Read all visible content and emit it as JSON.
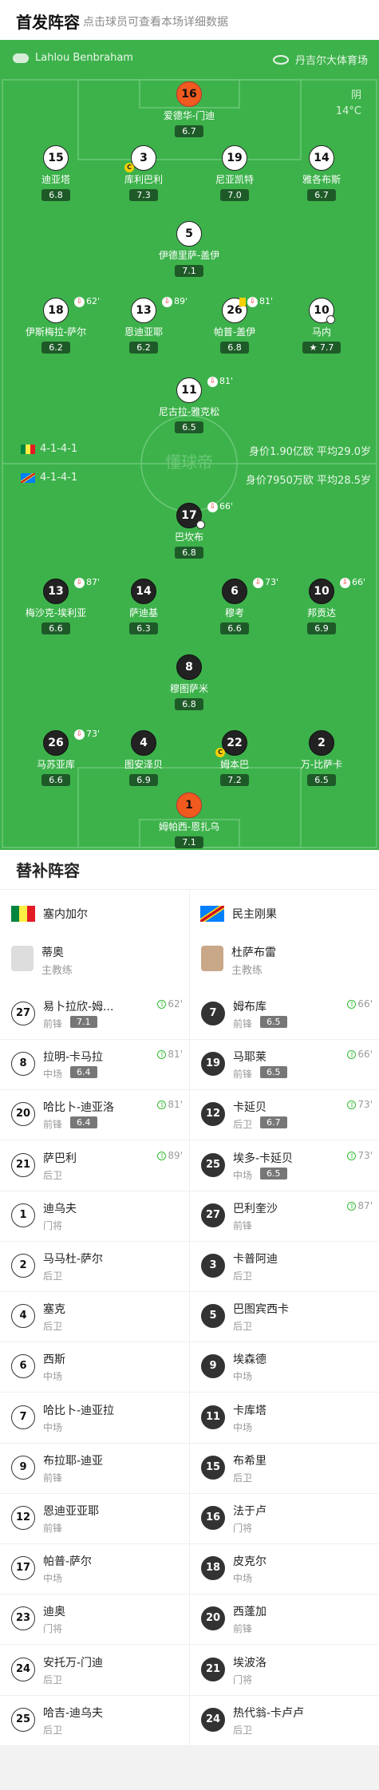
{
  "header": {
    "title": "首发阵容",
    "subtitle": "点击球员可查看本场详细数据"
  },
  "pitch": {
    "referee": "Lahlou Benbraham",
    "stadium": "丹吉尔大体育场",
    "weather": "阴",
    "temperature": "14°C",
    "watermark": "懂球帝",
    "home": {
      "formation": "4-1-4-1",
      "value": "身价1.90亿欧",
      "age": "平均29.0岁",
      "flag_colors": [
        "#00853f",
        "#fdef42",
        "#e31b23"
      ]
    },
    "away": {
      "formation": "4-1-4-1",
      "value": "身价7950万欧",
      "age": "平均28.5岁",
      "flag_colors": [
        "#007fff",
        "#f7d618",
        "#ce1021"
      ]
    }
  },
  "home_players": [
    {
      "num": "16",
      "name": "爱德华-门迪",
      "rating": "6.7"
    },
    {
      "num": "15",
      "name": "迪亚塔",
      "rating": "6.8"
    },
    {
      "num": "3",
      "name": "库利巴利",
      "rating": "7.3"
    },
    {
      "num": "19",
      "name": "尼亚凯特",
      "rating": "7.0"
    },
    {
      "num": "14",
      "name": "雅各布斯",
      "rating": "6.7"
    },
    {
      "num": "5",
      "name": "伊德里萨-盖伊",
      "rating": "7.1"
    },
    {
      "num": "18",
      "name": "伊斯梅拉-萨尔",
      "rating": "6.2",
      "sub": "62'"
    },
    {
      "num": "13",
      "name": "恩迪亚耶",
      "rating": "6.2",
      "sub": "89'"
    },
    {
      "num": "26",
      "name": "帕普-盖伊",
      "rating": "6.8",
      "sub": "81'"
    },
    {
      "num": "10",
      "name": "马内",
      "rating": "7.7"
    },
    {
      "num": "11",
      "name": "尼古拉-雅克松",
      "rating": "6.5",
      "sub": "81'"
    }
  ],
  "away_players": [
    {
      "num": "17",
      "name": "巴坎布",
      "rating": "6.8",
      "sub": "66'"
    },
    {
      "num": "13",
      "name": "梅沙克-埃利亚",
      "rating": "6.6",
      "sub": "87'"
    },
    {
      "num": "14",
      "name": "萨迪基",
      "rating": "6.3"
    },
    {
      "num": "6",
      "name": "穆考",
      "rating": "6.6",
      "sub": "73'"
    },
    {
      "num": "10",
      "name": "邦贡达",
      "rating": "6.9",
      "sub": "66'"
    },
    {
      "num": "8",
      "name": "穆图萨米",
      "rating": "6.8"
    },
    {
      "num": "26",
      "name": "马苏亚库",
      "rating": "6.6",
      "sub": "73'"
    },
    {
      "num": "4",
      "name": "图安泽贝",
      "rating": "6.9"
    },
    {
      "num": "22",
      "name": "姆本巴",
      "rating": "7.2"
    },
    {
      "num": "2",
      "name": "万-比萨卡",
      "rating": "6.5"
    },
    {
      "num": "1",
      "name": "姆帕西-恩扎乌",
      "rating": "7.1"
    }
  ],
  "bench": {
    "title": "替补阵容",
    "home_team": "塞内加尔",
    "away_team": "民主刚果",
    "home_coach": {
      "name": "蒂奥",
      "role": "主教练"
    },
    "away_coach": {
      "name": "杜萨布雷",
      "role": "主教练"
    },
    "home": [
      {
        "num": "27",
        "name": "易卜拉欣-姆...",
        "pos": "前锋",
        "rating": "7.1",
        "min": "62'"
      },
      {
        "num": "8",
        "name": "拉明-卡马拉",
        "pos": "中场",
        "rating": "6.4",
        "min": "81'"
      },
      {
        "num": "20",
        "name": "哈比卜-迪亚洛",
        "pos": "前锋",
        "rating": "6.4",
        "min": "81'"
      },
      {
        "num": "21",
        "name": "萨巴利",
        "pos": "后卫",
        "min": "89'"
      },
      {
        "num": "1",
        "name": "迪乌夫",
        "pos": "门将"
      },
      {
        "num": "2",
        "name": "马马杜-萨尔",
        "pos": "后卫"
      },
      {
        "num": "4",
        "name": "塞克",
        "pos": "后卫"
      },
      {
        "num": "6",
        "name": "西斯",
        "pos": "中场"
      },
      {
        "num": "7",
        "name": "哈比卜-迪亚拉",
        "pos": "中场"
      },
      {
        "num": "9",
        "name": "布拉耶-迪亚",
        "pos": "前锋"
      },
      {
        "num": "12",
        "name": "恩迪亚亚耶",
        "pos": "前锋"
      },
      {
        "num": "17",
        "name": "帕普-萨尔",
        "pos": "中场"
      },
      {
        "num": "23",
        "name": "迪奥",
        "pos": "门将"
      },
      {
        "num": "24",
        "name": "安托万-门迪",
        "pos": "后卫"
      },
      {
        "num": "25",
        "name": "哈吉-迪乌夫",
        "pos": "后卫"
      }
    ],
    "away": [
      {
        "num": "7",
        "name": "姆布库",
        "pos": "前锋",
        "rating": "6.5",
        "min": "66'"
      },
      {
        "num": "19",
        "name": "马耶莱",
        "pos": "前锋",
        "rating": "6.5",
        "min": "66'"
      },
      {
        "num": "12",
        "name": "卡延贝",
        "pos": "后卫",
        "rating": "6.7",
        "min": "73'"
      },
      {
        "num": "25",
        "name": "埃多-卡延贝",
        "pos": "中场",
        "rating": "6.5",
        "min": "73'"
      },
      {
        "num": "27",
        "name": "巴利奎沙",
        "pos": "前锋",
        "min": "87'"
      },
      {
        "num": "3",
        "name": "卡普阿迪",
        "pos": "后卫"
      },
      {
        "num": "5",
        "name": "巴图宾西卡",
        "pos": "后卫"
      },
      {
        "num": "9",
        "name": "埃森德",
        "pos": "中场"
      },
      {
        "num": "11",
        "name": "卡库塔",
        "pos": "中场"
      },
      {
        "num": "15",
        "name": "布希里",
        "pos": "后卫"
      },
      {
        "num": "16",
        "name": "法于卢",
        "pos": "门将"
      },
      {
        "num": "18",
        "name": "皮克尔",
        "pos": "中场"
      },
      {
        "num": "20",
        "name": "西蓬加",
        "pos": "前锋"
      },
      {
        "num": "21",
        "name": "埃波洛",
        "pos": "门将"
      },
      {
        "num": "24",
        "name": "热代翁-卡卢卢",
        "pos": "后卫"
      }
    ]
  }
}
